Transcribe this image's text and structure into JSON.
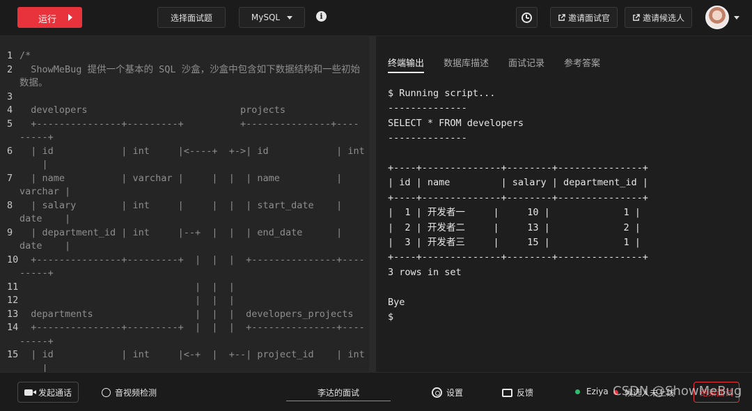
{
  "toolbar": {
    "run_label": "运行",
    "select_question_label": "选择面试题",
    "language": "MySQL",
    "invite_interviewer_label": "邀请面试官",
    "invite_candidate_label": "邀请候选人"
  },
  "editor": {
    "lines": [
      {
        "n": "1",
        "t": "/*"
      },
      {
        "n": "2",
        "t": "  ShowMeBug 提供一个基本的 SQL 沙盒，沙盒中包含如下数据结构和一些初始"
      },
      {
        "n": "",
        "t": "数据。"
      },
      {
        "n": "3",
        "t": ""
      },
      {
        "n": "4",
        "t": "  developers                           projects"
      },
      {
        "n": "5",
        "t": "  +---------------+---------+          +---------------+----"
      },
      {
        "n": "",
        "t": "-----+"
      },
      {
        "n": "6",
        "t": "  | id            | int     |<----+  +->| id            | int"
      },
      {
        "n": "",
        "t": "    |"
      },
      {
        "n": "7",
        "t": "  | name          | varchar |     |  |  | name          |"
      },
      {
        "n": "",
        "t": "varchar |"
      },
      {
        "n": "8",
        "t": "  | salary        | int     |     |  |  | start_date    |"
      },
      {
        "n": "",
        "t": "date    |"
      },
      {
        "n": "9",
        "t": "  | department_id | int     |--+  |  |  | end_date      |"
      },
      {
        "n": "",
        "t": "date    |"
      },
      {
        "n": "10",
        "t": "  +---------------+---------+  |  |  |  +---------------+----"
      },
      {
        "n": "",
        "t": "-----+"
      },
      {
        "n": "11",
        "t": "                               |  |  |"
      },
      {
        "n": "12",
        "t": "                               |  |  |"
      },
      {
        "n": "13",
        "t": "  departments                  |  |  |  developers_projects"
      },
      {
        "n": "14",
        "t": "  +---------------+---------+  |  |  |  +---------------+----"
      },
      {
        "n": "",
        "t": "-----+"
      },
      {
        "n": "15",
        "t": "  | id            | int     |<-+  |  +--| project_id    | int"
      },
      {
        "n": "",
        "t": "    |"
      }
    ]
  },
  "output": {
    "tabs": [
      {
        "label": "终端输出",
        "active": true
      },
      {
        "label": "数据库描述",
        "active": false
      },
      {
        "label": "面试记录",
        "active": false
      },
      {
        "label": "参考答案",
        "active": false
      }
    ],
    "console_lines": [
      "$ Running script...",
      "--------------",
      "SELECT * FROM developers",
      "--------------",
      "",
      "+----+--------------+--------+---------------+",
      "| id | name         | salary | department_id |",
      "+----+--------------+--------+---------------+",
      "|  1 | 开发者一     |     10 |             1 |",
      "|  2 | 开发者二     |     13 |             2 |",
      "|  3 | 开发者三     |     15 |             1 |",
      "+----+--------------+--------+---------------+",
      "3 rows in set",
      "",
      "Bye",
      "$"
    ]
  },
  "bottombar": {
    "call_label": "发起通话",
    "av_check_label": "音视频检测",
    "interview_title": "李达的面试",
    "settings_label": "设置",
    "feedback_label": "反馈",
    "user_name": "Eziya",
    "candidate_status": "候选人未上线",
    "end_label": "结束面试",
    "watermark": "CSDN @ShowMeBug",
    "status_colors": {
      "online": "#2ebd6b",
      "offline": "#e8323c"
    }
  }
}
